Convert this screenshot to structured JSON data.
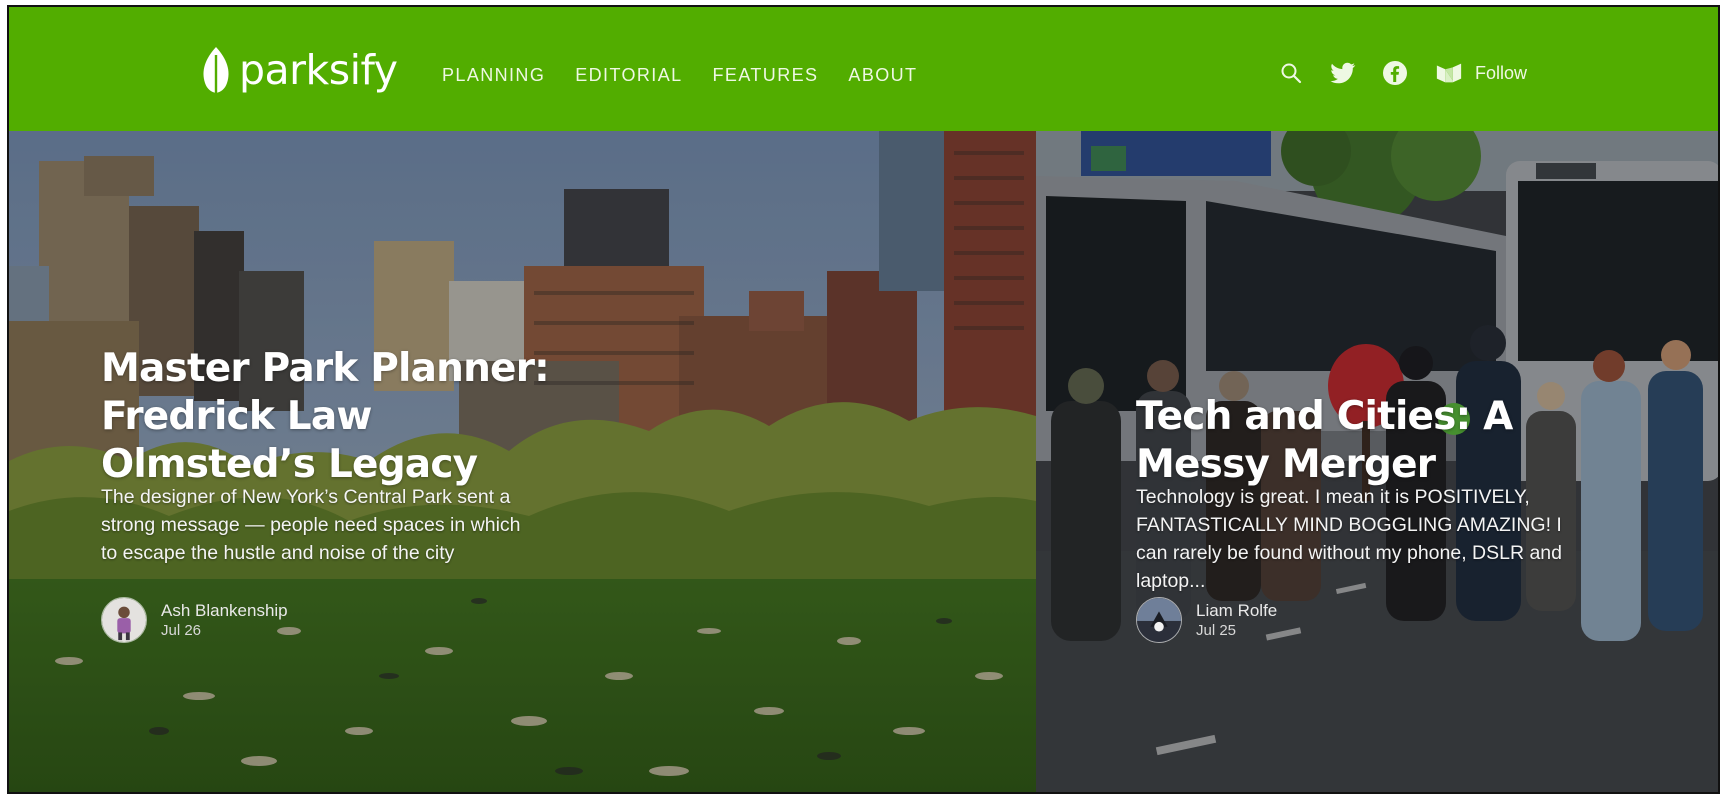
{
  "brand": {
    "name": "parksify",
    "color": "#52ad00"
  },
  "nav": {
    "items": [
      {
        "label": "PLANNING"
      },
      {
        "label": "EDITORIAL"
      },
      {
        "label": "FEATURES"
      },
      {
        "label": "ABOUT"
      }
    ]
  },
  "header_tools": {
    "icons": [
      "search-icon",
      "twitter-icon",
      "facebook-icon",
      "medium-icon"
    ],
    "follow_label": "Follow"
  },
  "posts": [
    {
      "title": "Master Park Planner: Fredrick Law Olmsted’s Legacy",
      "excerpt": "The designer of New York’s Central Park sent a strong message — people need spaces in which to escape the hustle and noise of the city",
      "author": "Ash Blankenship",
      "date": "Jul 26"
    },
    {
      "title": "Tech and Cities: A Messy Merger",
      "excerpt": "Technology is great. I mean it is POSITIVELY, FANTASTICALLY MIND BOGGLING AMAZING! I can rarely be found without my phone, DSLR and laptop...",
      "author": "Liam Rolfe",
      "date": "Jul 25"
    }
  ]
}
